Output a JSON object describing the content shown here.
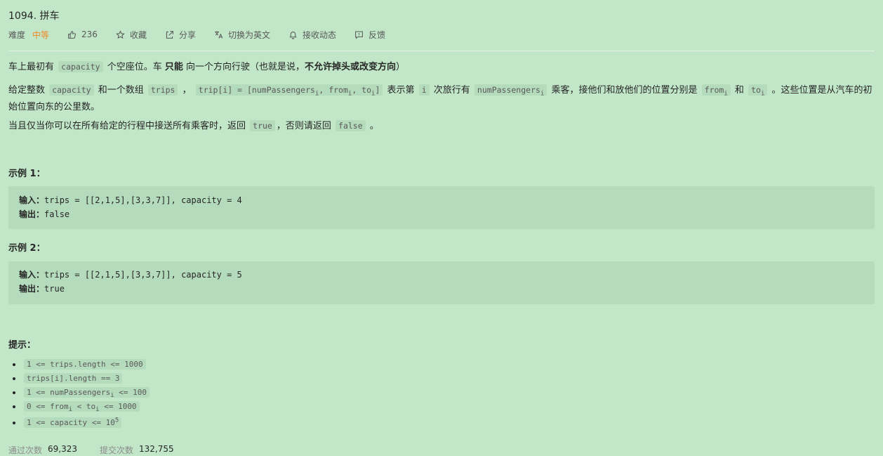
{
  "problem": {
    "title": "1094. 拼车",
    "difficulty_label": "难度",
    "difficulty": "中等",
    "likes": "236",
    "favorite": "收藏",
    "share": "分享",
    "switch_lang": "切换为英文",
    "follow": "接收动态",
    "feedback": "反馈"
  },
  "desc": {
    "p1_a": "车上最初有",
    "p1_code": "capacity",
    "p1_b": "个空座位。车",
    "p1_bold": "只能",
    "p1_c": "向一个方向行驶（也就是说，",
    "p1_bold2": "不允许掉头或改变方向",
    "p1_d": "）",
    "p2_a": "给定整数",
    "p2_code1": "capacity",
    "p2_b": "和一个数组",
    "p2_code2": "trips",
    "p2_c": "，",
    "p2_code3_a": "trip[i] = [numPassengers",
    "p2_code3_b": "i",
    "p2_code3_c": ", from",
    "p2_code3_d": "i",
    "p2_code3_e": ", to",
    "p2_code3_f": "i",
    "p2_code3_g": "]",
    "p2_d": "表示第",
    "p2_code4": "i",
    "p2_e": "次旅行有",
    "p2_code5_a": "numPassengers",
    "p2_code5_b": "i",
    "p2_f": "乘客，接他们和放他们的位置分别是",
    "p2_code6_a": "from",
    "p2_code6_b": "i",
    "p2_g": "和",
    "p2_code7_a": "to",
    "p2_code7_b": "i",
    "p2_h": "。这些位置是从汽车的初始位置向东的公里数。",
    "p3_a": "当且仅当你可以在所有给定的行程中接送所有乘客时，返回",
    "p3_code1": "true",
    "p3_b": "，否则请返回",
    "p3_code2": "false",
    "p3_c": "。"
  },
  "examples": [
    {
      "heading": "示例 1：",
      "input_label": "输入：",
      "input": "trips = [[2,1,5],[3,3,7]], capacity = 4",
      "output_label": "输出：",
      "output": "false"
    },
    {
      "heading": "示例 2：",
      "input_label": "输入：",
      "input": "trips = [[2,1,5],[3,3,7]], capacity = 5",
      "output_label": "输出：",
      "output": "true"
    }
  ],
  "tips": {
    "heading": "提示：",
    "t1": "1 <= trips.length <= 1000",
    "t2": "trips[i].length == 3",
    "t3_a": "1 <= numPassengers",
    "t3_b": "i",
    "t3_c": " <= 100",
    "t4_a": "0 <= from",
    "t4_b": "i",
    "t4_c": " < to",
    "t4_d": "i",
    "t4_e": " <= 1000",
    "t5_a": "1 <= capacity <= 10",
    "t5_b": "5"
  },
  "stats": {
    "accepted_label": "通过次数",
    "accepted": "69,323",
    "submitted_label": "提交次数",
    "submitted": "132,755"
  },
  "icons": [
    "thumb-up-icon",
    "star-icon",
    "share-icon",
    "translate-icon",
    "bell-icon",
    "feedback-icon"
  ],
  "colors": {
    "background": "#c1e6c8",
    "difficulty": "#ef8a2a",
    "code_bg": "#b5dbbd"
  }
}
